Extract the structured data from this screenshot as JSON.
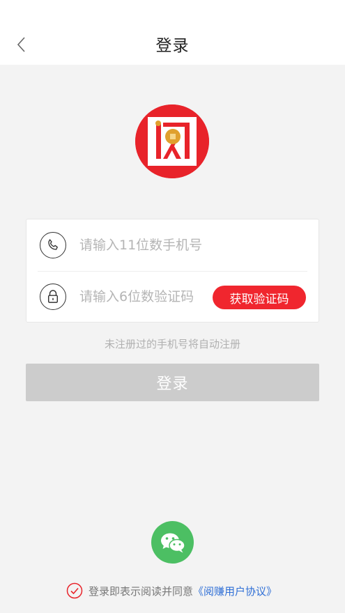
{
  "header": {
    "title": "登录",
    "back_icon": "chevron-left-icon"
  },
  "logo": {
    "icon": "app-logo-icon",
    "colors": {
      "background": "#e8232a",
      "coin": "#e0a02e"
    }
  },
  "form": {
    "phone": {
      "icon": "phone-icon",
      "placeholder": "请输入11位数手机号",
      "value": ""
    },
    "code": {
      "icon": "lock-icon",
      "placeholder": "请输入6位数验证码",
      "value": ""
    },
    "get_code_label": "获取验证码"
  },
  "hint": "未注册过的手机号将自动注册",
  "login_label": "登录",
  "wechat": {
    "icon": "wechat-icon",
    "color": "#4cbf63"
  },
  "agreement": {
    "check_icon": "check-circle-icon",
    "text": "登录即表示阅读并同意",
    "link": "《阅赚用户协议》"
  },
  "colors": {
    "accent": "#f0262e",
    "link": "#2f6fd6",
    "disabled_button": "#cccccc"
  }
}
